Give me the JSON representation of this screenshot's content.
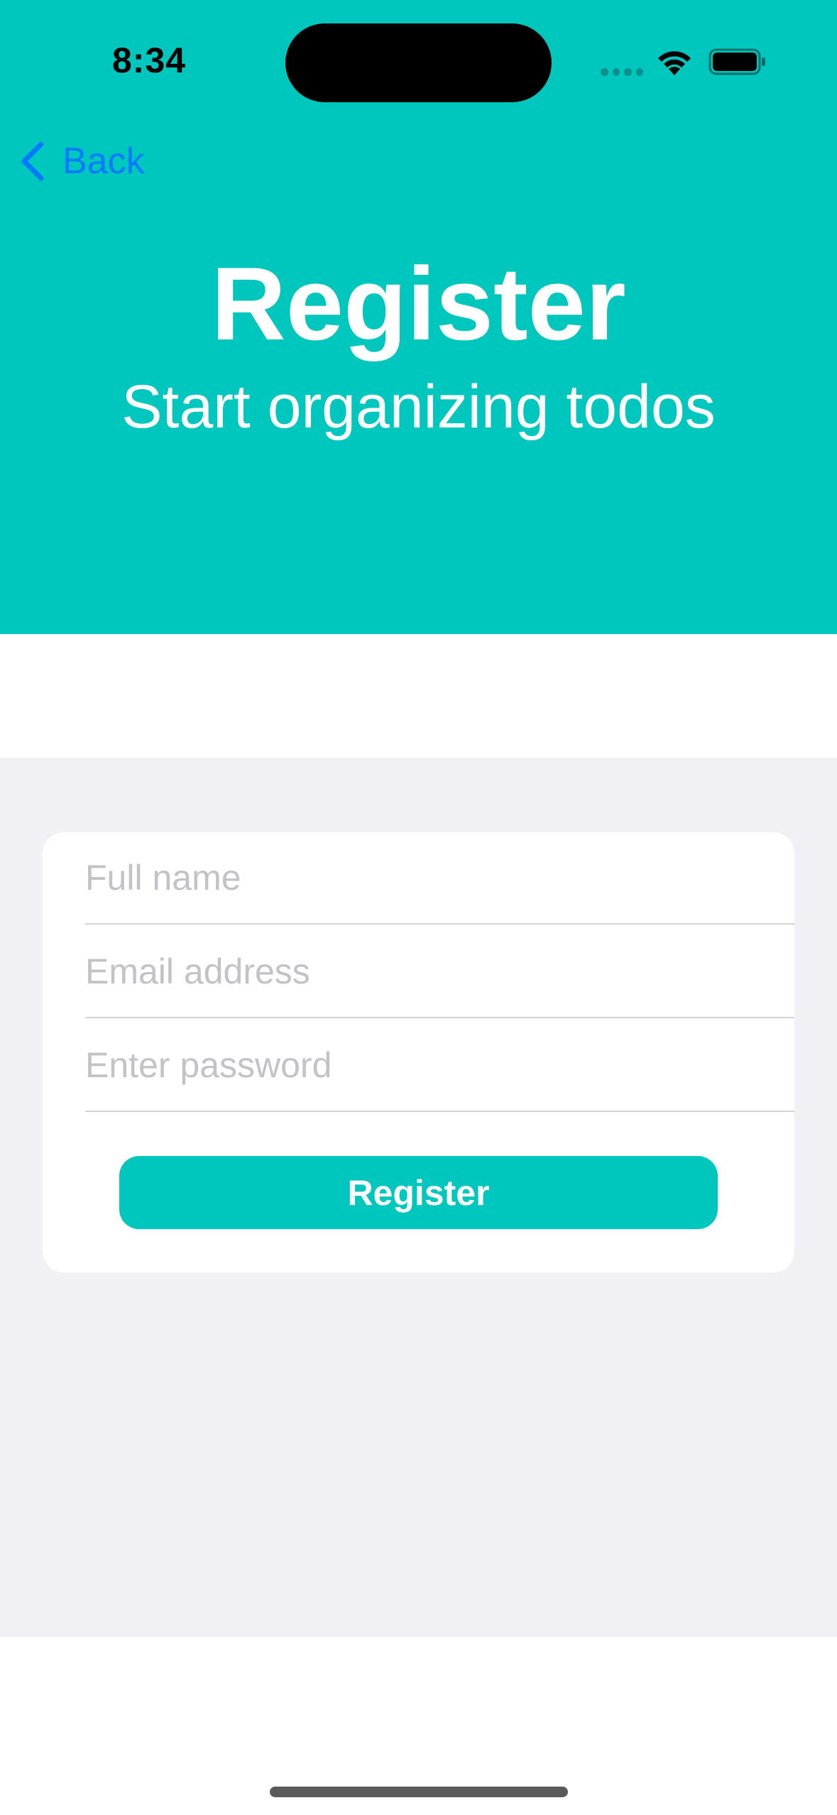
{
  "status_bar": {
    "time": "8:34"
  },
  "nav": {
    "back_label": "Back"
  },
  "header": {
    "title": "Register",
    "subtitle": "Start organizing todos"
  },
  "form": {
    "fields": [
      {
        "placeholder": "Full name",
        "value": ""
      },
      {
        "placeholder": "Email address",
        "value": ""
      },
      {
        "placeholder": "Enter password",
        "value": ""
      }
    ],
    "submit_label": "Register"
  },
  "colors": {
    "accent": "#00C7BE",
    "link": "#007AFF",
    "grouped_background": "#F0F0F5"
  },
  "icons": {
    "back": "chevron-left-icon",
    "wifi": "wifi-icon",
    "battery": "battery-icon",
    "signal": "cellular-signal-icon"
  }
}
